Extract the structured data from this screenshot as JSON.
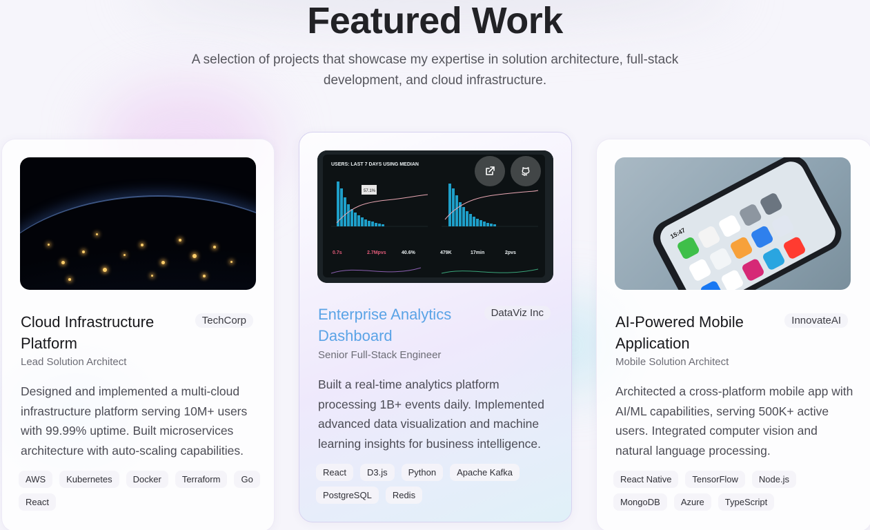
{
  "header": {
    "title": "Featured Work",
    "subtitle": "A selection of projects that showcase my expertise in solution architecture, full-stack development, and cloud infrastructure."
  },
  "projects": [
    {
      "title": "Cloud Infrastructure Platform",
      "company": "TechCorp",
      "role": "Lead Solution Architect",
      "description": "Designed and implemented a multi-cloud infrastructure platform serving 10M+ users with 99.99% uptime. Built microservices architecture with auto-scaling capabilities.",
      "tags": [
        "AWS",
        "Kubernetes",
        "Docker",
        "Terraform",
        "Go",
        "React"
      ],
      "image": "earth-night-lights"
    },
    {
      "title": "Enterprise Analytics Dashboard",
      "company": "DataViz Inc",
      "role": "Senior Full-Stack Engineer",
      "description": "Built a real-time analytics platform processing 1B+ events daily. Implemented advanced data visualization and machine learning insights for business intelligence.",
      "tags": [
        "React",
        "D3.js",
        "Python",
        "Apache Kafka",
        "PostgreSQL",
        "Redis"
      ],
      "image": "analytics-dashboard-tablet",
      "actions": [
        "external-link-icon",
        "github-icon"
      ],
      "screen": {
        "title": "USERS: LAST 7 DAYS USING MEDIAN",
        "callout": "57.1%",
        "metrics": [
          "0.7s",
          "2.7Mpvs",
          "40.6%",
          "479K",
          "17min",
          "2pvs"
        ]
      }
    },
    {
      "title": "AI-Powered Mobile Application",
      "company": "InnovateAI",
      "role": "Mobile Solution Architect",
      "description": "Architected a cross-platform mobile app with AI/ML capabilities, serving 500K+ active users. Integrated computer vision and natural language processing.",
      "tags": [
        "React Native",
        "TensorFlow",
        "Node.js",
        "MongoDB",
        "Azure",
        "TypeScript"
      ],
      "image": "smartphone-home-screen",
      "phone_time": "15:47"
    }
  ],
  "colors": {
    "accent_title": "#5aa3e6",
    "heading": "#222226",
    "background": "#f6f5fb"
  }
}
